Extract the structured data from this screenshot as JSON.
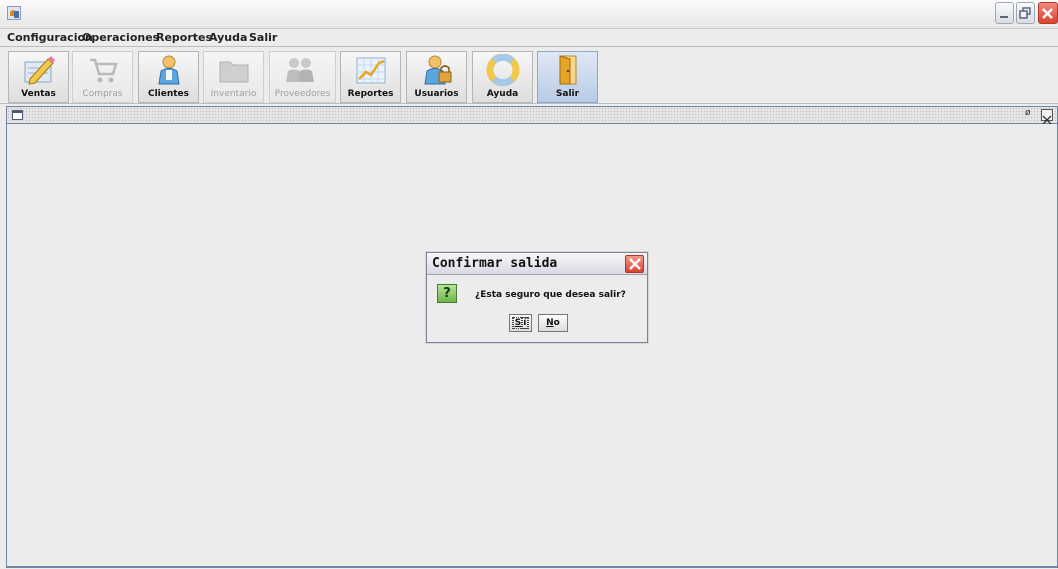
{
  "menu": [
    "Configuracion",
    "Operaciones",
    "Reportes",
    "Ayuda",
    "Salir"
  ],
  "toolbar": {
    "ventas": "Ventas",
    "compras": "Compras",
    "clientes": "Clientes",
    "inventario": "Inventario",
    "proveedores": "Proveedores",
    "reportes": "Reportes",
    "usuarios": "Usuarios",
    "ayuda": "Ayuda",
    "salir": "Salir"
  },
  "toolbar_icons": [
    "pencil-icon",
    "shopping-cart-icon",
    "user-icon",
    "folder-icon",
    "users-icon",
    "chart-icon",
    "user-lock-icon",
    "lifebuoy-icon",
    "door-icon"
  ],
  "dialog": {
    "title": "Confirmar salida",
    "question_mark": "?",
    "message": "¿Esta seguro que desea salir?",
    "yes_first": "S",
    "yes_rest": "í",
    "no_first": "N",
    "no_rest": "o"
  },
  "internal_frame": {
    "minimize_glyph": "ø"
  },
  "colors": {
    "frame_border": "#6f86a8",
    "active_button": "#b8cbe6",
    "close_red": "#d8432f",
    "question_green": "#6fb54a"
  }
}
